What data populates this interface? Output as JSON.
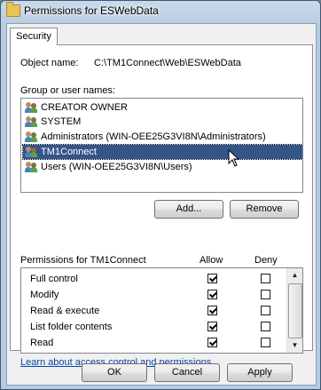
{
  "window": {
    "title": "Permissions for ESWebData"
  },
  "tabs": [
    {
      "label": "Security"
    }
  ],
  "object": {
    "label": "Object name:",
    "value": "C:\\TM1Connect\\Web\\ESWebData"
  },
  "groups": {
    "label": "Group or user names:",
    "items": [
      {
        "name": "CREATOR OWNER",
        "selected": false
      },
      {
        "name": "SYSTEM",
        "selected": false
      },
      {
        "name": "Administrators (WIN-OEE25G3VI8N\\Administrators)",
        "selected": false
      },
      {
        "name": "TM1Connect",
        "selected": true
      },
      {
        "name": "Users (WIN-OEE25G3VI8N\\Users)",
        "selected": false
      }
    ],
    "add_label": "Add...",
    "remove_label": "Remove"
  },
  "permissions": {
    "header": "Permissions for TM1Connect",
    "allow_header": "Allow",
    "deny_header": "Deny",
    "rows": [
      {
        "name": "Full control",
        "allow": true,
        "deny": false
      },
      {
        "name": "Modify",
        "allow": true,
        "deny": false
      },
      {
        "name": "Read & execute",
        "allow": true,
        "deny": false
      },
      {
        "name": "List folder contents",
        "allow": true,
        "deny": false
      },
      {
        "name": "Read",
        "allow": true,
        "deny": false
      }
    ]
  },
  "link": {
    "label": "Learn about access control and permissions"
  },
  "footer": {
    "ok_label": "OK",
    "cancel_label": "Cancel",
    "apply_label": "Apply"
  }
}
